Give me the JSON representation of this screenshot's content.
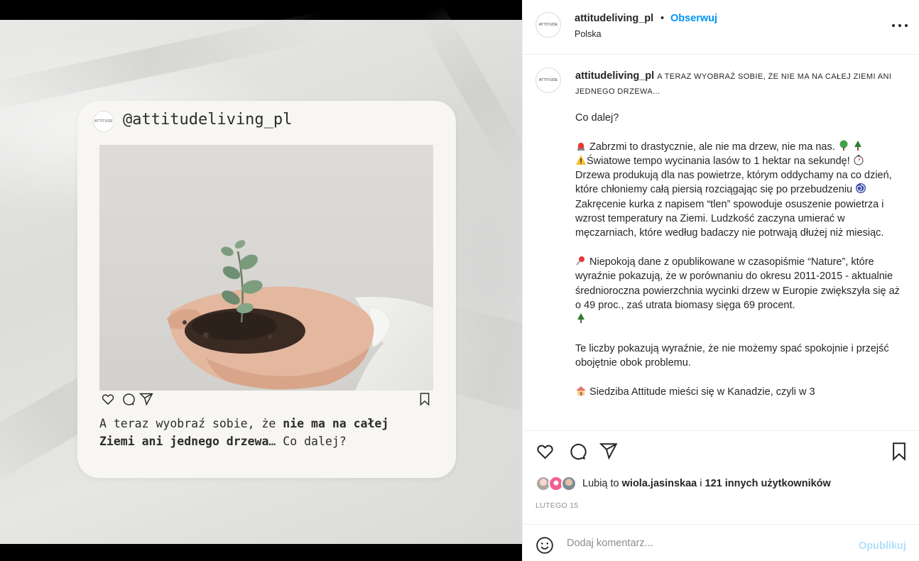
{
  "post": {
    "username": "attitudeliving_pl",
    "separator": "•",
    "follow_label": "Obserwuj",
    "location": "Polska",
    "avatar_text": "ATTITUDE",
    "more_icon": "more-horizontal-icon"
  },
  "image": {
    "handle": "@attitudeliving_pl",
    "avatar_text": "ATTITUDE",
    "text_normal_1": "A teraz wyobraź sobie, że ",
    "text_bold_1": "nie ma na całej",
    "text_bold_2": "Ziemi ani jednego drzewa",
    "text_normal_2": "… Co dalej?",
    "icons": [
      "heart-icon",
      "comment-icon",
      "share-icon",
      "bookmark-icon"
    ]
  },
  "caption": {
    "username": "attitudeliving_pl",
    "headline": "A teraz wyobraź sobie, że nie ma na całej Ziemi ani jednego drzewa...",
    "line_co_dalej": "Co dalej?",
    "p1_l1": "Zabrzmi to drastycznie, ale nie ma drzew, nie ma nas.",
    "p1_l2": "Światowe tempo wycinania lasów to 1 hektar na sekundę!",
    "p1_l3": "Drzewa produkują dla nas powietrze, którym oddychamy na co dzień, które chłoniemy całą piersią rozciągając się po przebudzeniu",
    "p1_l4": "Zakręcenie kurka z napisem “tlen” spowoduje osuszenie powietrza i wzrost temperatury na Ziemi. Ludzkość zaczyna umierać w męczarniach, które według badaczy nie potrwają dłużej niż miesiąc.",
    "p2": "Niepokoją dane z opublikowane w czasopiśmie “Nature”, które wyraźnie pokazują, że w porównaniu do okresu 2011-2015 - aktualnie średnioroczna powierzchnia wycinki drzew w Europie zwiększyła się aż o 49 proc., zaś utrata biomasy sięga 69 procent.",
    "p3": "Te liczby pokazują wyraźnie, że nie możemy spać spokojnie i przejść obojętnie obok problemu.",
    "p4": "Siedziba Attitude mieści się w Kanadzie, czyli w 3"
  },
  "likes": {
    "prefix": "Lubią to",
    "user": "wiola.jasinskaa",
    "conj": "i",
    "others": "121 innych użytkowników"
  },
  "date": "LUTEGO 15",
  "comment": {
    "placeholder": "Dodaj komentarz...",
    "publish_label": "Opublikuj"
  },
  "colors": {
    "link": "#0095f6",
    "publish_disabled": "#b2dffc",
    "muted": "#8e8e8e"
  }
}
